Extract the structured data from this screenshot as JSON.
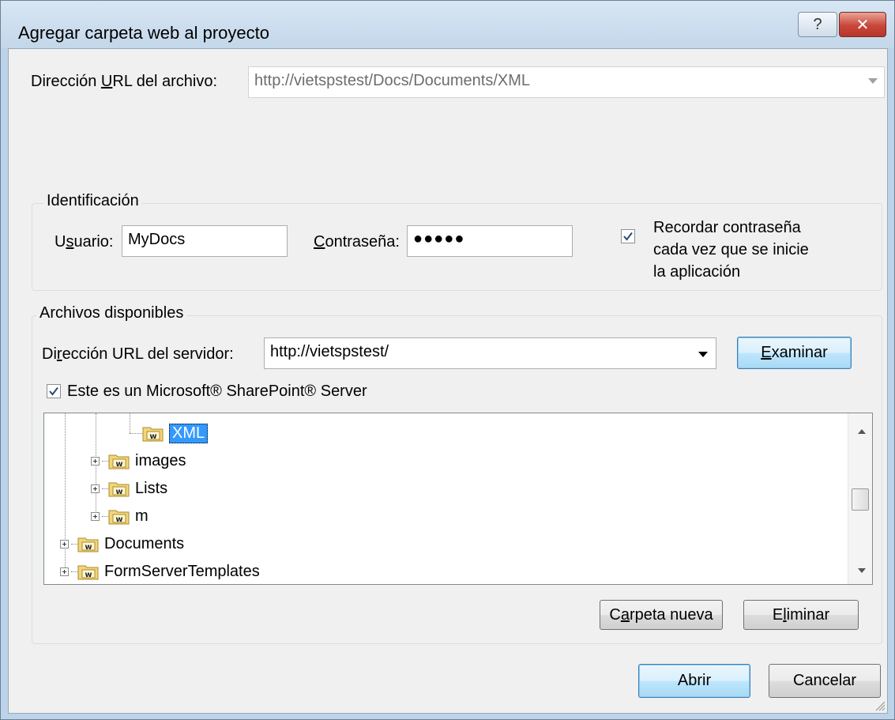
{
  "window": {
    "title": "Agregar carpeta web al proyecto",
    "help_label": "?",
    "close_label": "✕"
  },
  "file_url": {
    "label_prefix": "Dirección ",
    "label_accel": "U",
    "label_suffix": "RL del archivo:",
    "value": "http://vietspstest/Docs/Documents/XML"
  },
  "identification": {
    "title": "Identificación",
    "user_label_prefix": "U",
    "user_label_accel": "s",
    "user_label_suffix": "uario:",
    "user_value": "MyDocs",
    "password_label_accel": "C",
    "password_label_suffix": "ontraseña:",
    "password_value": "●●●●●",
    "remember_checked": true,
    "remember_line1": "Recordar contraseña",
    "remember_line2": "cada vez que se inicie",
    "remember_line3": "la aplicación"
  },
  "available_files": {
    "title": "Archivos disponibles",
    "server_label_prefix": "Di",
    "server_label_accel": "r",
    "server_label_suffix": "ección URL del servidor:",
    "server_value": "http://vietspstest/",
    "browse_accel": "E",
    "browse_suffix": "xaminar",
    "sharepoint_checked": true,
    "sharepoint_label": "Este es un Microsoft® SharePoint® Server",
    "tree": [
      {
        "label": "XML",
        "selected": true
      },
      {
        "label": "images",
        "selected": false
      },
      {
        "label": "Lists",
        "selected": false
      },
      {
        "label": "m",
        "selected": false
      },
      {
        "label": "Documents",
        "selected": false
      },
      {
        "label": "FormServerTemplates",
        "selected": false
      }
    ],
    "new_folder_prefix": "C",
    "new_folder_accel": "a",
    "new_folder_suffix": "rpeta nueva",
    "delete_prefix": "E",
    "delete_accel": "l",
    "delete_suffix": "iminar"
  },
  "footer": {
    "open_label": "Abrir",
    "cancel_label": "Cancelar"
  },
  "colors": {
    "selection": "#3399ff",
    "title_bar": "#c3d7ea",
    "dialog_bg": "#f0f0f0",
    "close_button": "#c9463a"
  }
}
